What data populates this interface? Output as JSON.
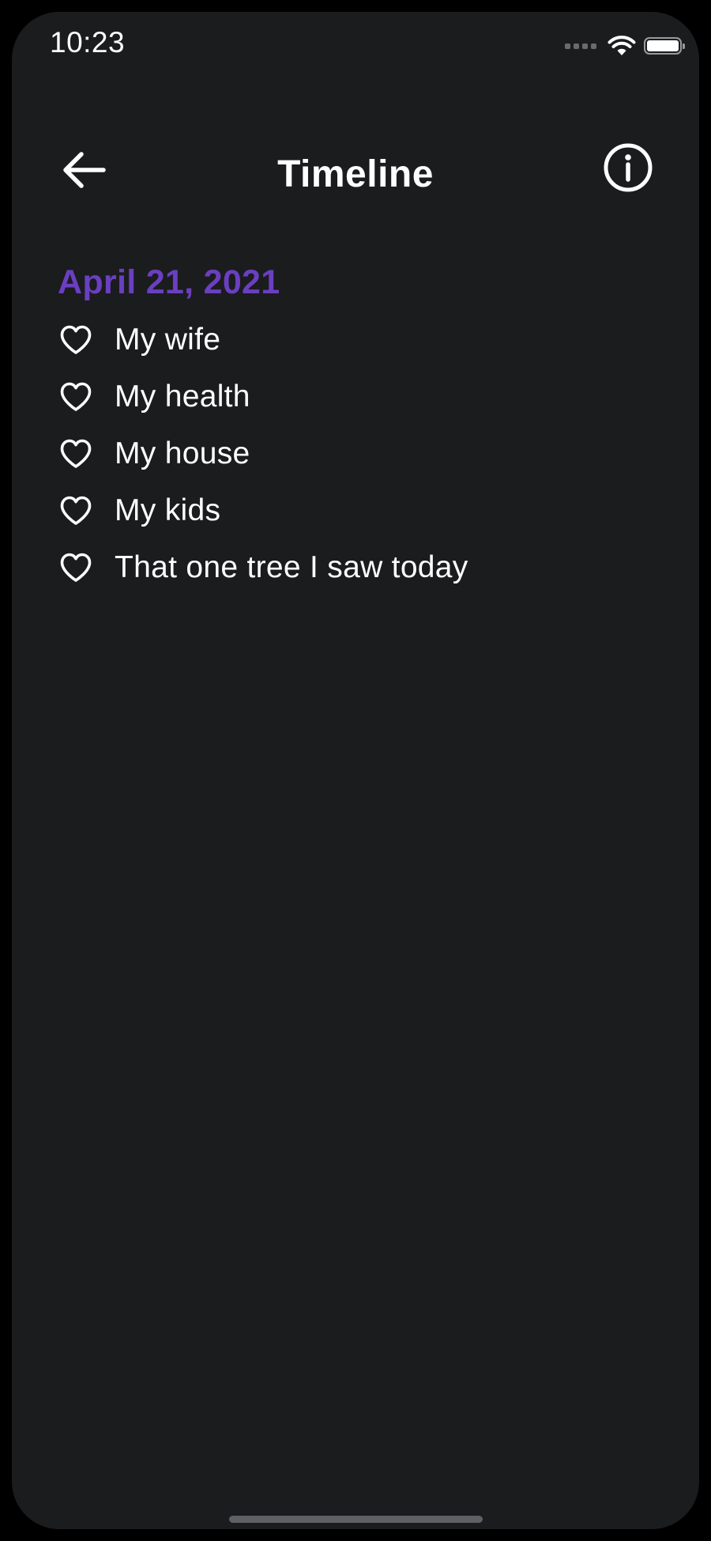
{
  "status_bar": {
    "time": "10:23",
    "icons": [
      "cellular-signal-icon",
      "wifi-icon",
      "battery-icon"
    ]
  },
  "nav": {
    "title": "Timeline",
    "back_icon": "arrow-left-icon",
    "info_icon": "info-circle-icon"
  },
  "timeline": {
    "date": "April 21, 2021",
    "items": [
      {
        "label": "My wife",
        "icon": "heart-icon"
      },
      {
        "label": "My health",
        "icon": "heart-icon"
      },
      {
        "label": "My house",
        "icon": "heart-icon"
      },
      {
        "label": "My kids",
        "icon": "heart-icon"
      },
      {
        "label": "That one tree I saw today",
        "icon": "heart-icon"
      }
    ]
  },
  "colors": {
    "background": "#1b1c1e",
    "accent": "#6a3fc0",
    "text": "#ffffff"
  }
}
